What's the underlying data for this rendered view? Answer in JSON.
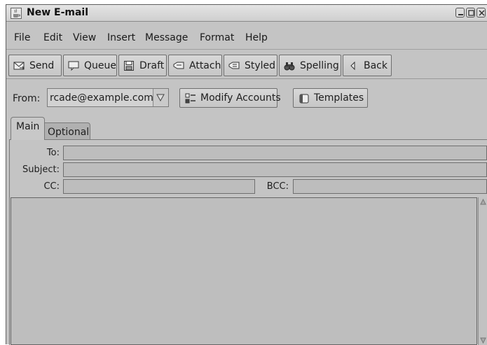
{
  "window": {
    "title": "New E-mail"
  },
  "menu": [
    "File",
    "Edit",
    "View",
    "Insert",
    "Message",
    "Format",
    "Help"
  ],
  "toolbar": {
    "send": "Send",
    "queue": "Queue",
    "draft": "Draft",
    "attach": "Attach",
    "styled": "Styled",
    "spelling": "Spelling",
    "back": "Back"
  },
  "from": {
    "label": "From:",
    "value": "rcade@example.com",
    "modify_accounts": "Modify Accounts",
    "templates": "Templates"
  },
  "tabs": {
    "main": "Main",
    "optional": "Optional"
  },
  "fields": {
    "to_label": "To:",
    "to_value": "",
    "subject_label": "Subject:",
    "subject_value": "",
    "cc_label": "CC:",
    "cc_value": "",
    "bcc_label": "BCC:",
    "bcc_value": "",
    "body_value": ""
  },
  "icons": {
    "app": "java-cup-icon",
    "minimize": "minimize-icon",
    "maximize": "maximize-icon",
    "close": "close-icon",
    "send": "send-icon",
    "queue": "queue-icon",
    "draft": "floppy-disk-icon",
    "attach": "paperclip-icon",
    "styled": "styled-icon",
    "spelling": "binoculars-icon",
    "back": "back-arrow-icon",
    "modify_accounts": "accounts-icon",
    "templates": "templates-icon",
    "dropdown": "dropdown-arrow-icon"
  }
}
